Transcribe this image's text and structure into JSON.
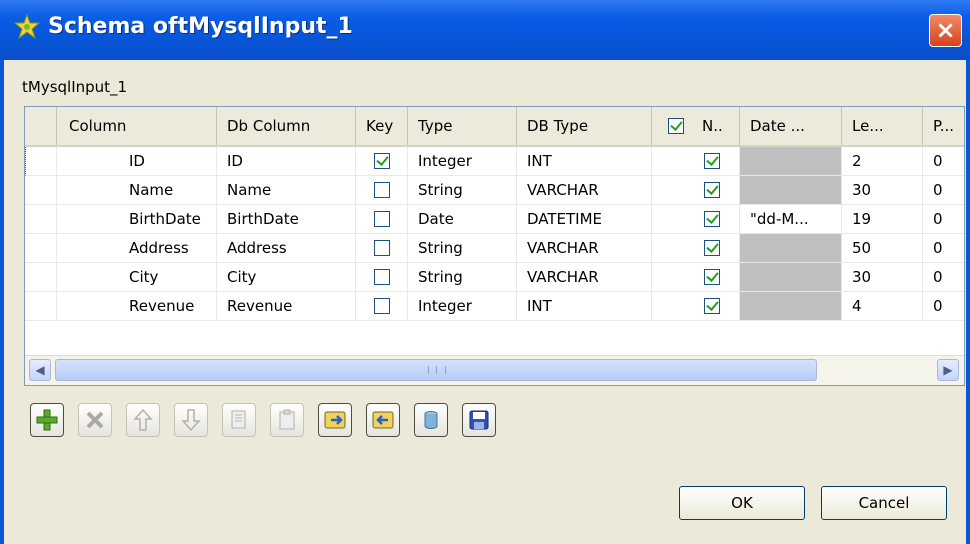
{
  "window": {
    "title": "Schema oftMysqlInput_1",
    "close_label": "×",
    "component_name": "tMysqlInput_1"
  },
  "table": {
    "headers": [
      "Column",
      "Db Column",
      "Key",
      "Type",
      "DB Type",
      "N..",
      "Date ...",
      "Le...",
      "P..."
    ],
    "rows": [
      {
        "column": "ID",
        "db_column": "ID",
        "key": true,
        "type": "Integer",
        "db_type": "INT",
        "nullable": true,
        "date": "",
        "length": "2",
        "precision": "0"
      },
      {
        "column": "Name",
        "db_column": "Name",
        "key": false,
        "type": "String",
        "db_type": "VARCHAR",
        "nullable": true,
        "date": "",
        "length": "30",
        "precision": "0"
      },
      {
        "column": "BirthDate",
        "db_column": "BirthDate",
        "key": false,
        "type": "Date",
        "db_type": "DATETIME",
        "nullable": true,
        "date": "\"dd-M...",
        "length": "19",
        "precision": "0"
      },
      {
        "column": "Address",
        "db_column": "Address",
        "key": false,
        "type": "String",
        "db_type": "VARCHAR",
        "nullable": true,
        "date": "",
        "length": "50",
        "precision": "0"
      },
      {
        "column": "City",
        "db_column": "City",
        "key": false,
        "type": "String",
        "db_type": "VARCHAR",
        "nullable": true,
        "date": "",
        "length": "30",
        "precision": "0"
      },
      {
        "column": "Revenue",
        "db_column": "Revenue",
        "key": false,
        "type": "Integer",
        "db_type": "INT",
        "nullable": true,
        "date": "",
        "length": "4",
        "precision": "0"
      }
    ]
  },
  "toolbar": {
    "add_icon": "plus-icon",
    "remove_icon": "delete-icon",
    "up_icon": "move-up-icon",
    "down_icon": "move-down-icon",
    "copy_icon": "copy-icon",
    "paste_icon": "paste-icon",
    "import_icon": "import-icon",
    "export_icon": "export-icon",
    "db_icon": "database-icon",
    "save_icon": "save-icon"
  },
  "buttons": {
    "ok": "OK",
    "cancel": "Cancel"
  },
  "colors": {
    "title_bar": "#0a5ce6",
    "dialog_bg": "#ece9d8",
    "check_green": "#21a121"
  }
}
